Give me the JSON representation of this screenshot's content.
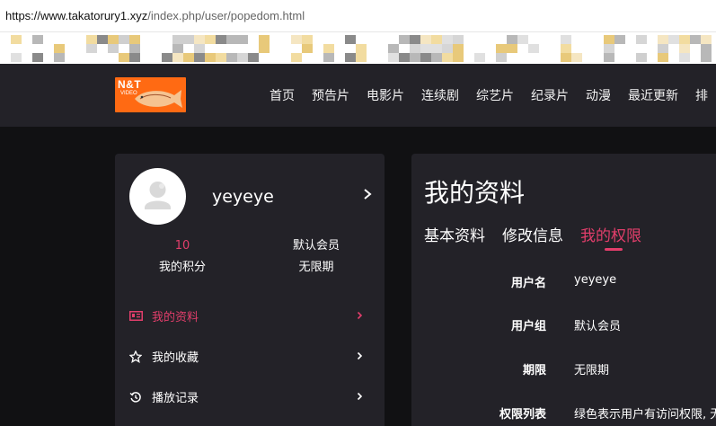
{
  "browser": {
    "url_host": "https://www.takatorury1.xyz",
    "url_path": "/index.php/user/popedom.html"
  },
  "header": {
    "logo_text": "N&T",
    "logo_sub": "VIDEO",
    "nav": [
      "首页",
      "预告片",
      "电影片",
      "连续剧",
      "综艺片",
      "纪录片",
      "动漫",
      "最近更新",
      "排"
    ]
  },
  "user": {
    "name": "yeyeye",
    "points_value": "10",
    "points_label": "我的积分",
    "group_value": "默认会员",
    "group_label": "无限期"
  },
  "menu": [
    {
      "label": "我的资料",
      "icon": "id-card-icon",
      "active": true
    },
    {
      "label": "我的收藏",
      "icon": "star-icon",
      "active": false
    },
    {
      "label": "播放记录",
      "icon": "history-icon",
      "active": false
    }
  ],
  "panel": {
    "title": "我的资料",
    "tabs": [
      {
        "label": "基本资料",
        "active": false
      },
      {
        "label": "修改信息",
        "active": false
      },
      {
        "label": "我的权限",
        "active": true
      }
    ],
    "rows": [
      {
        "key": "用户名",
        "value": "yeyeye"
      },
      {
        "key": "用户组",
        "value": "默认会员"
      },
      {
        "key": "期限",
        "value": "无限期"
      },
      {
        "key": "权限列表",
        "value": "绿色表示用户有访问权限, 无"
      }
    ]
  },
  "colors": {
    "accent": "#e23e6b",
    "header_bg": "#232228",
    "page_bg": "#111113",
    "logo_bg": "#ff6a13"
  }
}
